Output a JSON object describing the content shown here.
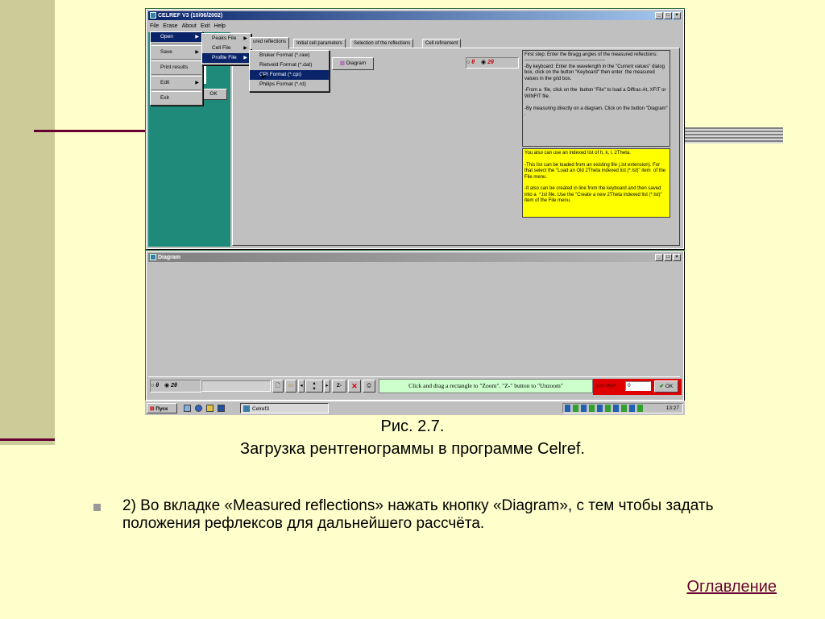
{
  "celref": {
    "title": "CELREF V3 (10/06/2002)",
    "menu": [
      "File",
      "Erase",
      "About",
      "Exit",
      "Help"
    ],
    "file_menu": [
      "Open",
      "Save",
      "Print results",
      "Edit",
      "Exit"
    ],
    "open_submenu": [
      "Peaks File",
      "Cell File",
      "Profile File"
    ],
    "profile_submenu": [
      "Bruker Format (*.raw)",
      "Rietveld Format (*.dat)",
      "CPI Format (*.cpi)",
      "Philips Format (*.rd)"
    ],
    "tabs": [
      "ured reflections",
      "Initial cell parameters",
      "Selection of the reflections",
      "Cell refinement"
    ],
    "diagram_button": "Diagram",
    "ok_button": "OK",
    "theta_option": "θ",
    "twotheta_option": "2θ",
    "info_first": "First step: Enter the Bragg angles of the measured reflections:\n--------------------------------------------------\n-By keyboard: Enter the wavelength in the \"Current values\" dialog box, click on the button \"Keyboard\" then enter  the measured values in the grid box.\n\n-From a  file, click on the  button \"File\" to load a Diffrac-At, XFIT or WINFIT file.\n\n-By measuring directly on a diagram. Click on the button \"Diagram\" .",
    "info_second": "You also can use an indexed list of h, k, l, 2Theta.\n\n-This list can be loaded from an existing file (.lst extension). For that select the \"Load an Old 2Theta indexed list (*.lst)\" item  of the File menu.\n\n-It also can be created in line from the keyboard and then saved into a  *.lst file. Use the \"Create a new 2Theta indexed list (*.lst)\" item of the File menu."
  },
  "diagram": {
    "title": "Diagram",
    "theta_option": "θ",
    "twotheta_option": "2θ",
    "zoom_button": "Z-",
    "hint": "Click and drag a rectangle to \"Zoom\".  \"Z-\" button to \"Unzoom\"",
    "zero_offset_label": "Zero offset",
    "zero_offset_value": "0",
    "ok_button": "OK"
  },
  "taskbar": {
    "start": "Пуск",
    "task": "Celref3",
    "clock": "13:27"
  },
  "caption": {
    "fig": "Рис. 2.7.",
    "text": "Загрузка рентгенограммы в программе Celref."
  },
  "bullet": "2) Во вкладке «Measured reflections» нажать кнопку «Diagram», с тем чтобы задать положения рефлексов для дальнейшего рассчёта.",
  "toc_link": "Оглавление"
}
